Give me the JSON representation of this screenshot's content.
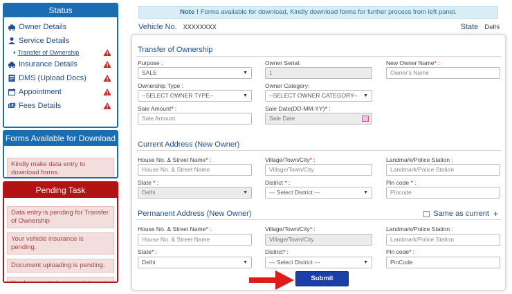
{
  "colors": {
    "primary": "#1a6cb3",
    "danger": "#b31313",
    "submit": "#1a3fa8",
    "note_bg": "#d9edf7",
    "alert_bg": "#f3dede"
  },
  "status": {
    "title": "Status",
    "items": [
      {
        "label": "Owner Details",
        "icon": "car-icon",
        "warn": false
      },
      {
        "label": "Service Details",
        "icon": "user-icon",
        "warn": false
      },
      {
        "label": "Insurance Details",
        "icon": "car-icon",
        "warn": true
      },
      {
        "label": "DMS (Upload Docs)",
        "icon": "document-icon",
        "warn": true
      },
      {
        "label": "Appointment",
        "icon": "calendar-icon",
        "warn": true
      },
      {
        "label": "Fees Details",
        "icon": "money-icon",
        "warn": true
      }
    ],
    "sub_item": {
      "label": "Transfer of Ownership",
      "warn": true
    }
  },
  "forms_panel": {
    "title": "Forms Available for Download",
    "message": "Kindly make data entry to download forms."
  },
  "pending": {
    "title": "Pending Task",
    "items": [
      "Data entry is pending for Transfer of Ownership",
      "Your vehicle insurance is pending.",
      "Document uploading is pending.",
      "You have not taken appointment."
    ]
  },
  "note": {
    "bold": "Note !",
    "text": "Forms available for download, Kindly download forms for further process from left panel."
  },
  "vehicle": {
    "label": "Vehicle No.",
    "number": "XXXXXXXX",
    "state_label": "State",
    "state_value": "Delhi"
  },
  "transfer": {
    "title": "Transfer of Ownership",
    "purpose_label": "Purpose :",
    "purpose_value": "SALE",
    "owner_serial_label": "Owner Serial:",
    "owner_serial_value": "1",
    "new_owner_label": "New Owner Name",
    "new_owner_colon": " :",
    "new_owner_placeholder": "Owner's Name",
    "ownership_type_label": "Ownership Type :",
    "ownership_type_value": "--SELECT OWNER TYPE--",
    "owner_category_label": "Owner Category:",
    "owner_category_value": "--SELECT OWNER CATEGORY--",
    "sale_amount_label": "Sale Amount",
    "sale_amount_colon": " :",
    "sale_amount_placeholder": "Sale Amount",
    "sale_date_label": "Sale Date(DD-MM-YY)",
    "sale_date_colon": " :",
    "sale_date_placeholder": "Sale Date"
  },
  "current_address": {
    "title": "Current Address (New Owner)",
    "house_label": "House No. & Street Name",
    "house_placeholder": "House No. & Street Name",
    "village_label": "Village/Town/City",
    "village_placeholder": "Village/Town/City",
    "landmark_label": "Landmark/Police Station :",
    "landmark_placeholder": "Landmark/Police Station",
    "state_label": "State",
    "state_value": "Delhi",
    "district_label": "District",
    "district_value": "--- Select District ---",
    "pin_label": "Pin code",
    "pin_placeholder": "Pincode"
  },
  "permanent_address": {
    "title": "Permanent Address (New Owner)",
    "same_as_current": "Same as current",
    "house_label": "House No. & Street Name",
    "house_placeholder": "House No. & Street Name",
    "village_label": "Village/Town/City",
    "village_placeholder": "Village/Town/City",
    "landmark_label": "Landmark/Police Station :",
    "landmark_placeholder": "Landmark/Police Station",
    "state_label": "State",
    "state_value": "Delhi",
    "district_label": "District",
    "district_value": "--- Select District ---",
    "pin_label": "Pin code",
    "pin_placeholder": "PinCode"
  },
  "submit_label": "Submit",
  "req_mark": "*",
  "colon": " :"
}
